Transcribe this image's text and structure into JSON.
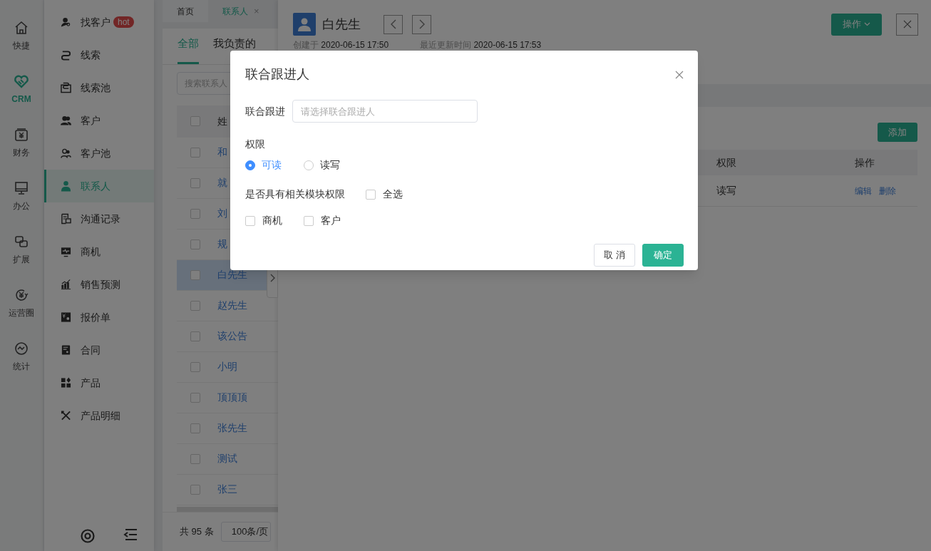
{
  "rail": [
    {
      "label": "快捷",
      "selected": false
    },
    {
      "label": "CRM",
      "selected": true
    },
    {
      "label": "财务",
      "selected": false
    },
    {
      "label": "办公",
      "selected": false
    },
    {
      "label": "扩展",
      "selected": false
    },
    {
      "label": "运营圈",
      "selected": false
    },
    {
      "label": "统计",
      "selected": false
    }
  ],
  "nav": [
    {
      "label": "找客户",
      "badge": "hot",
      "selected": false
    },
    {
      "label": "线索",
      "selected": false
    },
    {
      "label": "线索池",
      "selected": false
    },
    {
      "label": "客户",
      "selected": false
    },
    {
      "label": "客户池",
      "selected": false
    },
    {
      "label": "联系人",
      "selected": true
    },
    {
      "label": "沟通记录",
      "selected": false
    },
    {
      "label": "商机",
      "selected": false
    },
    {
      "label": "销售预测",
      "selected": false
    },
    {
      "label": "报价单",
      "selected": false
    },
    {
      "label": "合同",
      "selected": false
    },
    {
      "label": "产品",
      "selected": false
    },
    {
      "label": "产品明细",
      "selected": false
    }
  ],
  "page_tabs": [
    {
      "label": "首页",
      "selected": false
    },
    {
      "label": "联系人",
      "selected": true,
      "close": "×"
    }
  ],
  "list": {
    "tabs": [
      {
        "label": "全部",
        "selected": true
      },
      {
        "label": "我负责的",
        "selected": false
      }
    ],
    "search": {
      "placeholder": "搜索联系人"
    },
    "header": "姓",
    "header_checked": false,
    "rows": [
      {
        "name": "和",
        "checked": false,
        "selected": false
      },
      {
        "name": "就",
        "checked": false,
        "selected": false
      },
      {
        "name": "刘",
        "checked": false,
        "selected": false
      },
      {
        "name": "规",
        "checked": false,
        "selected": false
      },
      {
        "name": "白先生",
        "checked": false,
        "selected": true
      },
      {
        "name": "赵先生",
        "checked": false,
        "selected": false
      },
      {
        "name": "该公告",
        "checked": false,
        "selected": false
      },
      {
        "name": "小明",
        "checked": false,
        "selected": false
      },
      {
        "name": "顶顶顶",
        "checked": false,
        "selected": false
      },
      {
        "name": "张先生",
        "checked": false,
        "selected": false
      },
      {
        "name": "测试",
        "checked": false,
        "selected": false
      },
      {
        "name": "张三",
        "checked": false,
        "selected": false
      }
    ],
    "total": "共 95 条",
    "page_size": "100条/页"
  },
  "detail": {
    "name": "白先生",
    "action_button": "操作",
    "meta": [
      {
        "label": "创建于",
        "value": "2020-06-15 17:50"
      },
      {
        "label": "最近更新时间",
        "value": "2020-06-15 17:53"
      }
    ],
    "add_button": "添加",
    "table": {
      "columns": [
        "权限",
        "操作"
      ],
      "rows": [
        {
          "permission": "读写",
          "actions": [
            "编辑",
            "删除"
          ]
        }
      ]
    }
  },
  "dialog": {
    "title": "联合跟进人",
    "field_label": "联合跟进",
    "field_placeholder": "请选择联合跟进人",
    "permission_label": "权限",
    "permissions": [
      {
        "label": "可读",
        "selected": true
      },
      {
        "label": "读写",
        "selected": false
      }
    ],
    "module_label": "是否具有相关模块权限",
    "select_all": {
      "label": "全选",
      "checked": false
    },
    "modules": [
      {
        "label": "商机",
        "checked": false
      },
      {
        "label": "客户",
        "checked": false
      }
    ],
    "buttons": [
      {
        "label": "取 消",
        "kind": "secondary"
      },
      {
        "label": "确定",
        "kind": "primary"
      }
    ]
  }
}
